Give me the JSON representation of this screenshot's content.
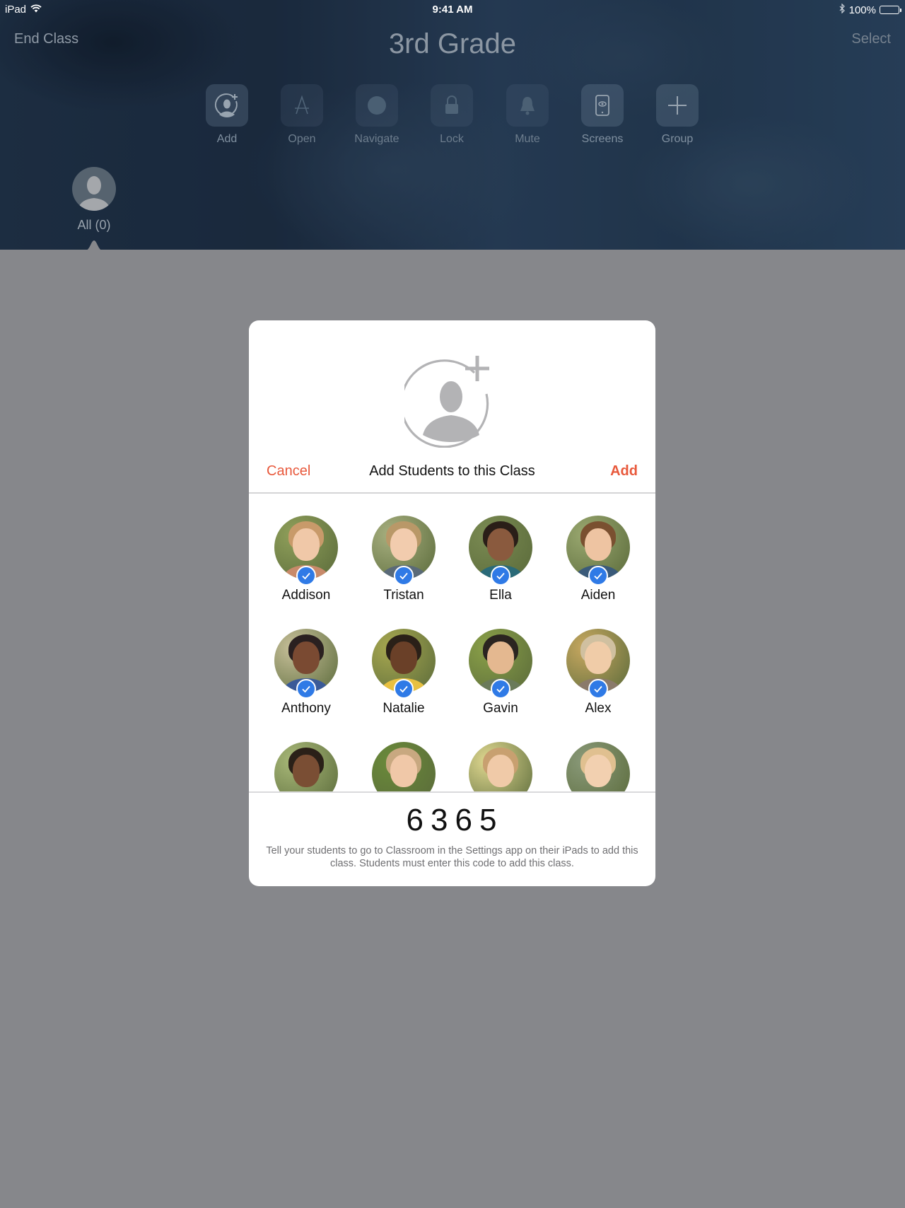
{
  "status_bar": {
    "device": "iPad",
    "time": "9:41 AM",
    "battery": "100%",
    "battery_level": 1.0
  },
  "nav": {
    "left_label": "End Class",
    "title": "3rd Grade",
    "right_label": "Select"
  },
  "toolbar": {
    "items": [
      {
        "label": "Add",
        "icon": "add-person-icon",
        "enabled": true
      },
      {
        "label": "Open",
        "icon": "app-store-icon",
        "enabled": false
      },
      {
        "label": "Navigate",
        "icon": "compass-icon",
        "enabled": false
      },
      {
        "label": "Lock",
        "icon": "lock-icon",
        "enabled": false
      },
      {
        "label": "Mute",
        "icon": "bell-icon",
        "enabled": false
      },
      {
        "label": "Screens",
        "icon": "screen-view-icon",
        "enabled": true
      },
      {
        "label": "Group",
        "icon": "plus-icon",
        "enabled": true
      }
    ]
  },
  "groups": {
    "all_label": "All (0)"
  },
  "modal": {
    "cancel_label": "Cancel",
    "title": "Add Students to this Class",
    "add_label": "Add",
    "accent_color": "#e8593c",
    "check_color": "#2f7ae6",
    "students": [
      {
        "name": "Addison",
        "selected": true
      },
      {
        "name": "Tristan",
        "selected": true
      },
      {
        "name": "Ella",
        "selected": true
      },
      {
        "name": "Aiden",
        "selected": true
      },
      {
        "name": "Anthony",
        "selected": true
      },
      {
        "name": "Natalie",
        "selected": true
      },
      {
        "name": "Gavin",
        "selected": true
      },
      {
        "name": "Alex",
        "selected": true
      },
      {
        "name": "",
        "selected": false
      },
      {
        "name": "",
        "selected": false
      },
      {
        "name": "",
        "selected": false
      },
      {
        "name": "",
        "selected": false
      }
    ],
    "class_code": "6365",
    "help_text": "Tell your students to go to Classroom in the Settings app on their iPads to add this class. Students must enter this code to add this class."
  }
}
